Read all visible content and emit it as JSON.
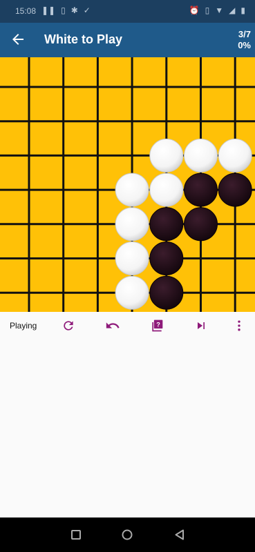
{
  "status_bar": {
    "time": "15:08"
  },
  "app_bar": {
    "title": "White to Play",
    "progress": "3/7",
    "percent": "0%"
  },
  "board": {
    "grid_size": 8,
    "background": "#ffc107",
    "stones": [
      {
        "color": "white",
        "col": 4,
        "row": 2
      },
      {
        "color": "white",
        "col": 5,
        "row": 2
      },
      {
        "color": "white",
        "col": 6,
        "row": 2
      },
      {
        "color": "white",
        "col": 3,
        "row": 3
      },
      {
        "color": "white",
        "col": 4,
        "row": 3
      },
      {
        "color": "black",
        "col": 5,
        "row": 3
      },
      {
        "color": "black",
        "col": 6,
        "row": 3
      },
      {
        "color": "white",
        "col": 3,
        "row": 4
      },
      {
        "color": "black",
        "col": 4,
        "row": 4
      },
      {
        "color": "black",
        "col": 5,
        "row": 4
      },
      {
        "color": "white",
        "col": 3,
        "row": 5
      },
      {
        "color": "black",
        "col": 4,
        "row": 5
      },
      {
        "color": "white",
        "col": 3,
        "row": 6
      },
      {
        "color": "black",
        "col": 4,
        "row": 6
      }
    ]
  },
  "toolbar": {
    "status": "Playing",
    "accent": "#8e1a7a",
    "buttons": [
      "refresh-icon",
      "undo-icon",
      "hint-icon",
      "skip-next-icon",
      "more-vert-icon"
    ]
  },
  "nav_bar": {
    "buttons": [
      "recents-icon",
      "home-icon",
      "back-icon"
    ]
  }
}
